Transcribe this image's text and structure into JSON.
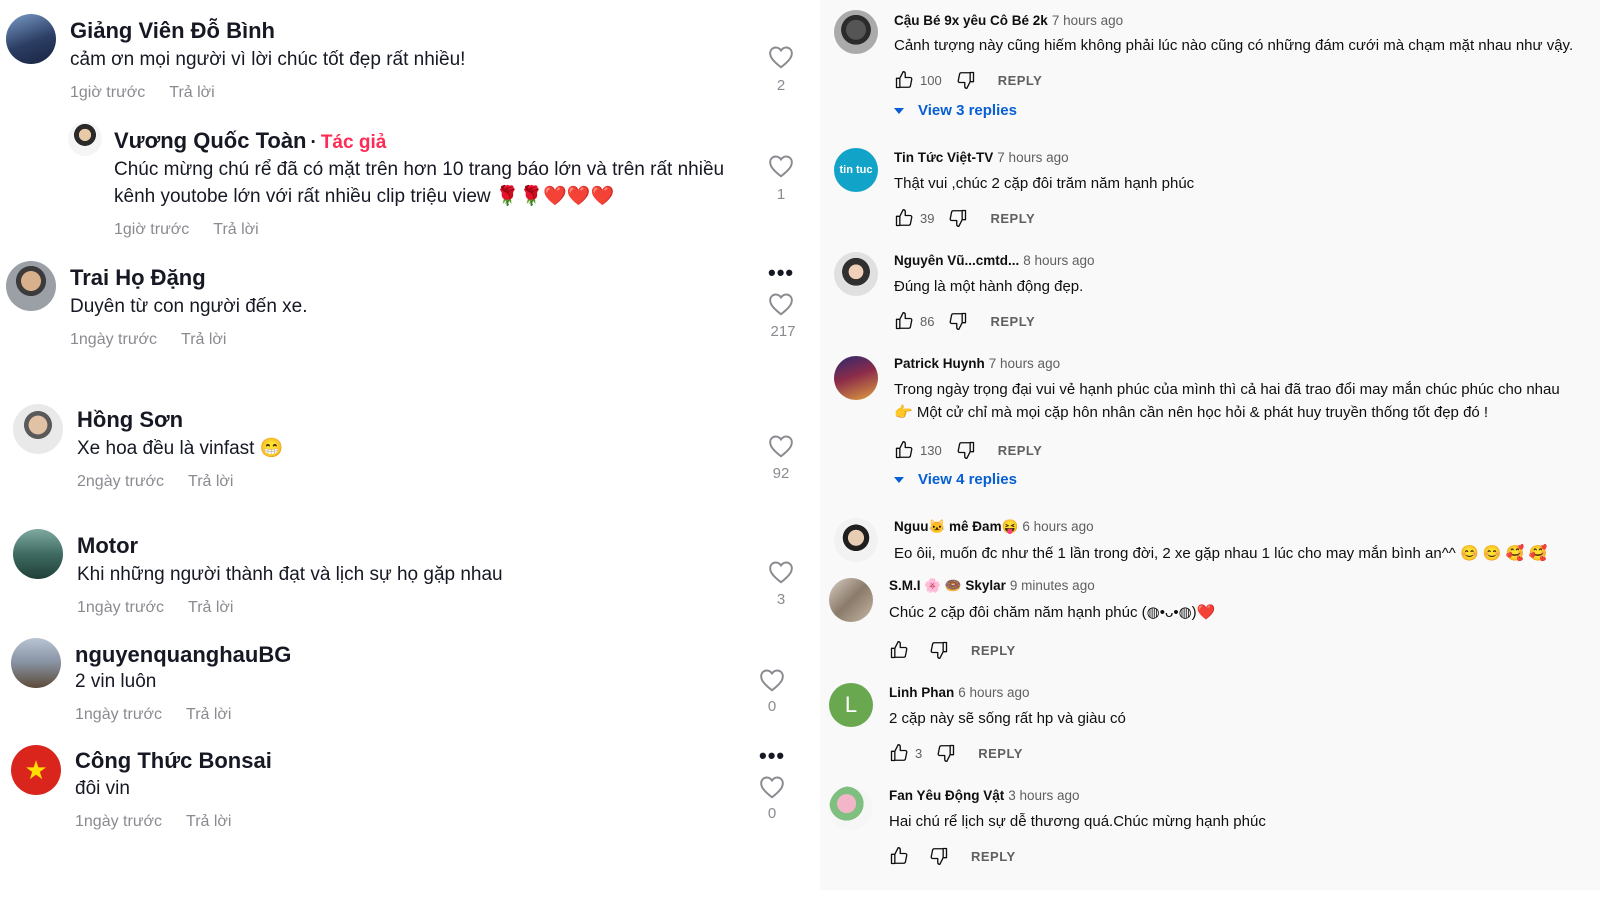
{
  "left": {
    "comments": [
      {
        "name": "Giảng Viên Đỗ Bình",
        "text": "cảm ơn mọi người vì lời chúc tốt đẹp rất nhiều!",
        "time": "1giờ trước",
        "reply": "Trả lời",
        "likes": "2"
      },
      {
        "name": "Vương Quốc Toàn",
        "author_tag": "Tác giả",
        "dot": "·",
        "text1": "Chúc mừng chú rể đã có mặt trên hơn 10 trang báo lớn và trên rất nhiều",
        "text2": "kênh youtobe lớn với rất nhiều clip triệu view 🌹🌹❤️❤️❤️",
        "time": "1giờ trước",
        "reply": "Trả lời",
        "likes": "1"
      },
      {
        "name": "Trai Họ Đặng",
        "text": "Duyên từ con người đến xe.",
        "time": "1ngày trước",
        "reply": "Trả lời",
        "likes": "217",
        "more": "•••"
      },
      {
        "name": "Hồng Sơn",
        "text": "Xe hoa đều là vinfast 😁",
        "time": "2ngày trước",
        "reply": "Trả lời",
        "likes": "92"
      },
      {
        "name": "Motor",
        "text": "Khi những người thành đạt và lịch sự họ gặp nhau",
        "time": "1ngày trước",
        "reply": "Trả lời",
        "likes": "3"
      },
      {
        "name": "nguyenquanghauBG",
        "text": "2 vin luôn",
        "time": "1ngày trước",
        "reply": "Trả lời",
        "likes": "0"
      },
      {
        "name": "Công Thức Bonsai",
        "text": "đôi vin",
        "time": "1ngày trước",
        "reply": "Trả lời",
        "likes": "0",
        "more": "•••"
      }
    ]
  },
  "right": {
    "reply_label": "REPLY",
    "comments": [
      {
        "author": "Cậu Bé 9x yêu Cô Bé 2k",
        "time": "7 hours ago",
        "text": "Cảnh tượng này cũng hiếm không phải lúc nào cũng có những đám cưới mà chạm mặt nhau như vậy.",
        "likes": "100",
        "view_replies": "View 3 replies"
      },
      {
        "author": "Tin Tức Việt-TV",
        "time": "7 hours ago",
        "text": "Thật vui ,chúc 2 cặp đôi trăm năm hạnh phúc",
        "likes": "39",
        "avatar_text": "tin tuc"
      },
      {
        "author": "Nguyên Vũ...cmtd...",
        "time": "8 hours ago",
        "text": "Đúng là một hành động đẹp.",
        "likes": "86"
      },
      {
        "author": "Patrick Huynh",
        "time": "7 hours ago",
        "text1": "Trong ngày trọng đại vui vẻ hạnh phúc của mình thì cả hai đã trao đổi may mắn chúc phúc cho nhau",
        "text2": "👉 Một cử chỉ mà mọi cặp hôn nhân cần nên học hỏi & phát huy truyền thống tốt đẹp đó !",
        "likes": "130",
        "view_replies": "View 4 replies"
      },
      {
        "author": "Nguu🐱 mê Đam😝",
        "time": "6 hours ago",
        "text": "Eo ôii, muốn đc như thế 1 lần trong đời, 2 xe gặp nhau 1 lúc cho may mắn bình an^^ 😊 😊 🥰 🥰"
      },
      {
        "author": "S.M.I 🌸 🍩 Skylar",
        "time": "9 minutes ago",
        "text": "Chúc 2 cặp đôi chăm năm hạnh phúc (◍•ᴗ•◍)❤️",
        "likes": ""
      },
      {
        "author": "Linh Phan",
        "time": "6 hours ago",
        "text": "2 cặp này sẽ sống rất hp và giàu có",
        "likes": "3",
        "avatar_letter": "L"
      },
      {
        "author": "Fan Yêu Động Vật",
        "time": "3 hours ago",
        "text": "Hai chú rể lịch sự dễ thương quá.Chúc mừng hạnh phúc",
        "likes": ""
      }
    ]
  },
  "colors": {
    "author_tag": "#fe2c55",
    "link": "#065fd4",
    "avatar_letter_bg": "#6aa84f"
  }
}
